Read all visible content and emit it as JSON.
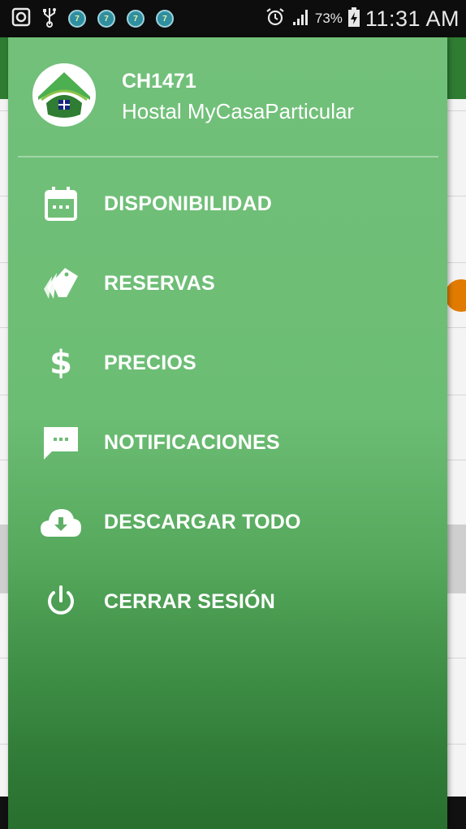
{
  "status_bar": {
    "battery_percent": "73%",
    "time": "11:31 AM",
    "notification_badge": "7",
    "icons": [
      "screenshot-icon",
      "usb-icon",
      "app-notification-icon",
      "alarm-icon",
      "signal-icon",
      "battery-charging-icon"
    ]
  },
  "drawer": {
    "header": {
      "user_id": "CH1471",
      "user_name": "Hostal MyCasaParticular",
      "logo": "house-logo-icon"
    },
    "items": [
      {
        "label": "DISPONIBILIDAD",
        "icon": "calendar-icon"
      },
      {
        "label": "RESERVAS",
        "icon": "tags-icon"
      },
      {
        "label": "PRECIOS",
        "icon": "dollar-icon"
      },
      {
        "label": "NOTIFICACIONES",
        "icon": "chat-icon"
      },
      {
        "label": "DESCARGAR TODO",
        "icon": "cloud-download-icon"
      },
      {
        "label": "CERRAR SESIÓN",
        "icon": "power-icon"
      }
    ]
  },
  "colors": {
    "drawer_top": "#72c07a",
    "drawer_bottom": "#296f2f",
    "toolbar": "#2e7d32",
    "accent_orange": "#e07b00"
  }
}
